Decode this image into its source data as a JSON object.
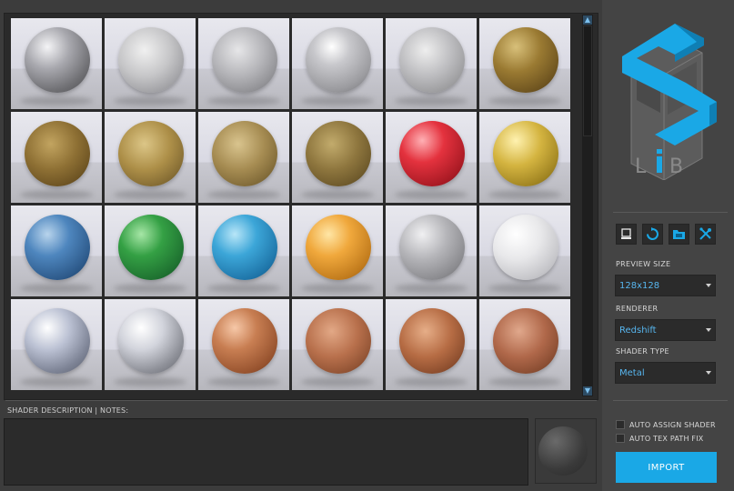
{
  "grid": {
    "tiles": [
      {
        "name": "chrome-ball",
        "bg": "radial-gradient(circle at 35% 30%,#f4f4f6 0%,#a8a8ae 35%,#707074 70%,#4a4a4e 100%)"
      },
      {
        "name": "satin-silver",
        "bg": "radial-gradient(circle at 40% 35%,#f0f0f0 0%,#c6c6c8 45%,#9a9a9e 80%,#7c7c80 100%)"
      },
      {
        "name": "brushed-silver",
        "bg": "radial-gradient(circle at 40% 35%,#e6e6e8 0%,#b4b4b8 45%,#8a8a8e 80%,#6a6a6e 100%)"
      },
      {
        "name": "polished-silver",
        "bg": "radial-gradient(circle at 40% 30%,#ffffff 0%,#c8c8cc 30%,#9c9ca0 70%,#707074 100%)"
      },
      {
        "name": "rough-silver",
        "bg": "radial-gradient(circle at 40% 35%,#eeeeee 0%,#bdbdc0 45%,#979799 80%,#767678 100%)"
      },
      {
        "name": "antique-gold",
        "bg": "radial-gradient(circle at 35% 30%,#d8c07a 0%,#9a7a32 40%,#6e5420 75%,#4a3612 100%)"
      },
      {
        "name": "hammered-gold",
        "bg": "radial-gradient(circle at 40% 35%,#c2a460 0%,#8e7034 45%,#674e20 80%,#4a3815 100%)"
      },
      {
        "name": "brushed-gold",
        "bg": "radial-gradient(circle at 40% 35%,#dcc687 0%,#ad8f48 45%,#7d6530 80%,#5c4820 100%)"
      },
      {
        "name": "satin-brass",
        "bg": "radial-gradient(circle at 40% 35%,#d9c48e 0%,#a68c52 45%,#7a6434 80%,#594822 100%)"
      },
      {
        "name": "dark-brass",
        "bg": "radial-gradient(circle at 40% 35%,#c2ab6c 0%,#8e763e 45%,#685428 80%,#4a3b1c 100%)"
      },
      {
        "name": "red-metal",
        "bg": "radial-gradient(circle at 35% 30%,#ffb0b4 0%,#e4323e 35%,#a81a24 75%,#70101a 100%)"
      },
      {
        "name": "yellow-gold",
        "bg": "radial-gradient(circle at 35% 30%,#fff2b0 0%,#d4b440 40%,#a08422 75%,#6e5a16 100%)"
      },
      {
        "name": "blue-metal",
        "bg": "radial-gradient(circle at 35% 30%,#b8d4ec 0%,#4e86be 35%,#2c5888 75%,#1c3a5c 100%)"
      },
      {
        "name": "green-metal",
        "bg": "radial-gradient(circle at 35% 30%,#a6e6a6 0%,#34a044 35%,#1e7030 75%,#124a20 100%)"
      },
      {
        "name": "cyan-metal",
        "bg": "radial-gradient(circle at 35% 30%,#b8e6f8 0%,#3ca6d8 35%,#1e74a8 75%,#144e74 100%)"
      },
      {
        "name": "orange-metal",
        "bg": "radial-gradient(circle at 35% 30%,#ffe6a6 0%,#f0a83c 35%,#c07a1c 75%,#8a5212 100%)"
      },
      {
        "name": "grey-metal",
        "bg": "radial-gradient(circle at 35% 30%,#f0f0f2 0%,#b4b4b8 40%,#8a8a8e 75%,#636366 100%)"
      },
      {
        "name": "white-pearl",
        "bg": "radial-gradient(circle at 35% 30%,#ffffff 0%,#e8e8ea 40%,#c4c4c8 75%,#9e9ea2 100%)"
      },
      {
        "name": "chrome-blue-tint",
        "bg": "radial-gradient(circle at 35% 30%,#ffffff 0%,#bcc2d4 35%,#7e8496 70%,#555a68 100%)"
      },
      {
        "name": "chrome-clear",
        "bg": "radial-gradient(circle at 35% 30%,#ffffff 0%,#d2d4dc 35%,#8e9098 70%,#5e6068 100%)"
      },
      {
        "name": "copper-polished",
        "bg": "radial-gradient(circle at 35% 30%,#f6c8a8 0%,#c87e52 35%,#96522e 75%,#62341c 100%)"
      },
      {
        "name": "copper-hammered",
        "bg": "radial-gradient(circle at 40% 35%,#e2a886 0%,#b8704c 45%,#8a4e30 80%,#5e341e 100%)"
      },
      {
        "name": "copper-satin",
        "bg": "radial-gradient(circle at 40% 35%,#e6ae88 0%,#b66c44 45%,#84482a 80%,#5a301c 100%)"
      },
      {
        "name": "copper-dark",
        "bg": "radial-gradient(circle at 40% 35%,#e0a88c 0%,#b0684a 45%,#82482e 80%,#5a301e 100%)"
      }
    ]
  },
  "description": {
    "label": "SHADER DESCRIPTION | NOTES:"
  },
  "tools": [
    {
      "name": "monitor-icon"
    },
    {
      "name": "refresh-icon"
    },
    {
      "name": "folder-icon"
    },
    {
      "name": "wrench-icon"
    }
  ],
  "preview_size": {
    "label": "PREVIEW SIZE",
    "value": "128x128"
  },
  "renderer": {
    "label": "RENDERER",
    "value": "Redshift"
  },
  "shader_type": {
    "label": "SHADER TYPE",
    "value": "Metal"
  },
  "options": {
    "auto_assign": "AUTO ASSIGN SHADER",
    "auto_tex": "AUTO TEX PATH FIX"
  },
  "import_label": "IMPORT",
  "colors": {
    "accent": "#1aa8e6",
    "panel": "#444444",
    "field": "#2b2b2b",
    "value_text": "#57b6ef"
  }
}
